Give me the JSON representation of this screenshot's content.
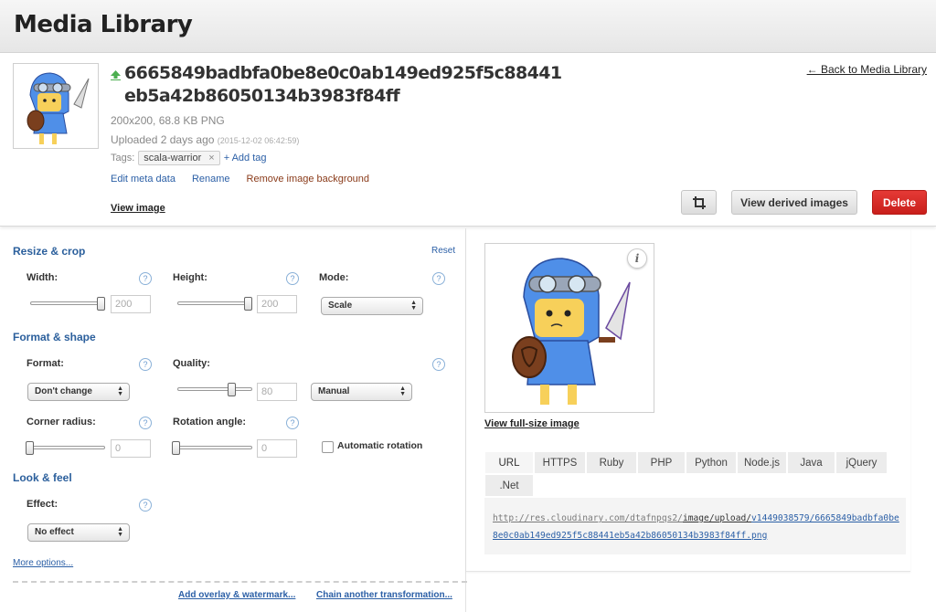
{
  "app": {
    "title": "Media Library"
  },
  "asset": {
    "filename_line1": "6665849badbfa0be8e0c0ab149ed925f5c88441",
    "filename_line2": "eb5a42b86050134b3983f84ff",
    "dimensions": "200x200, 68.8 KB PNG",
    "uploaded": "Uploaded 2 days ago",
    "uploaded_ts": "(2015-12-02 06:42:59)",
    "tags_label": "Tags:",
    "tags": [
      {
        "name": "scala-warrior",
        "remove": "×"
      }
    ],
    "add_tag": "+ Add tag",
    "actions": {
      "edit_meta": "Edit meta data",
      "rename": "Rename",
      "remove_bg": "Remove image background"
    },
    "view_image": "View image",
    "back_link": "← Back to Media Library",
    "buttons": {
      "derived": "View derived images",
      "delete": "Delete"
    }
  },
  "transform": {
    "resize_crop": "Resize & crop",
    "reset": "Reset",
    "width_label": "Width:",
    "width_value": "200",
    "height_label": "Height:",
    "height_value": "200",
    "mode_label": "Mode:",
    "mode_value": "Scale",
    "format_shape": "Format & shape",
    "format_label": "Format:",
    "format_value": "Don't change",
    "quality_label": "Quality:",
    "quality_value": "80",
    "quality_mode": "Manual",
    "corner_label": "Corner radius:",
    "corner_value": "0",
    "rotation_label": "Rotation angle:",
    "rotation_value": "0",
    "auto_rotation": "Automatic rotation",
    "look_feel": "Look & feel",
    "effect_label": "Effect:",
    "effect_value": "No effect",
    "more_options": "More options...",
    "add_overlay": "Add overlay & watermark...",
    "chain": "Chain another transformation...",
    "help": "?"
  },
  "preview": {
    "info": "i",
    "full_size": "View full-size image",
    "tabs": [
      "URL",
      "HTTPS",
      "Ruby",
      "PHP",
      "Python",
      "Node.js",
      "Java",
      "jQuery",
      ".Net"
    ],
    "url_base": "http://res.cloudinary.com/dtafnpqs2/",
    "url_mid": "image/upload/",
    "url_rest": "v1449038579/6665849badbfa0be8e0c0ab149ed925f5c88441eb5a42b86050134b3983f84ff.png"
  },
  "icons": {
    "upload": "upload-arrow-icon",
    "crop": "crop-icon",
    "info": "info-icon",
    "help": "help-icon"
  },
  "colors": {
    "link": "#2b5fa6",
    "delete": "#d52a26",
    "section": "#2b5f9c",
    "upload_arrow": "#4caf50"
  }
}
